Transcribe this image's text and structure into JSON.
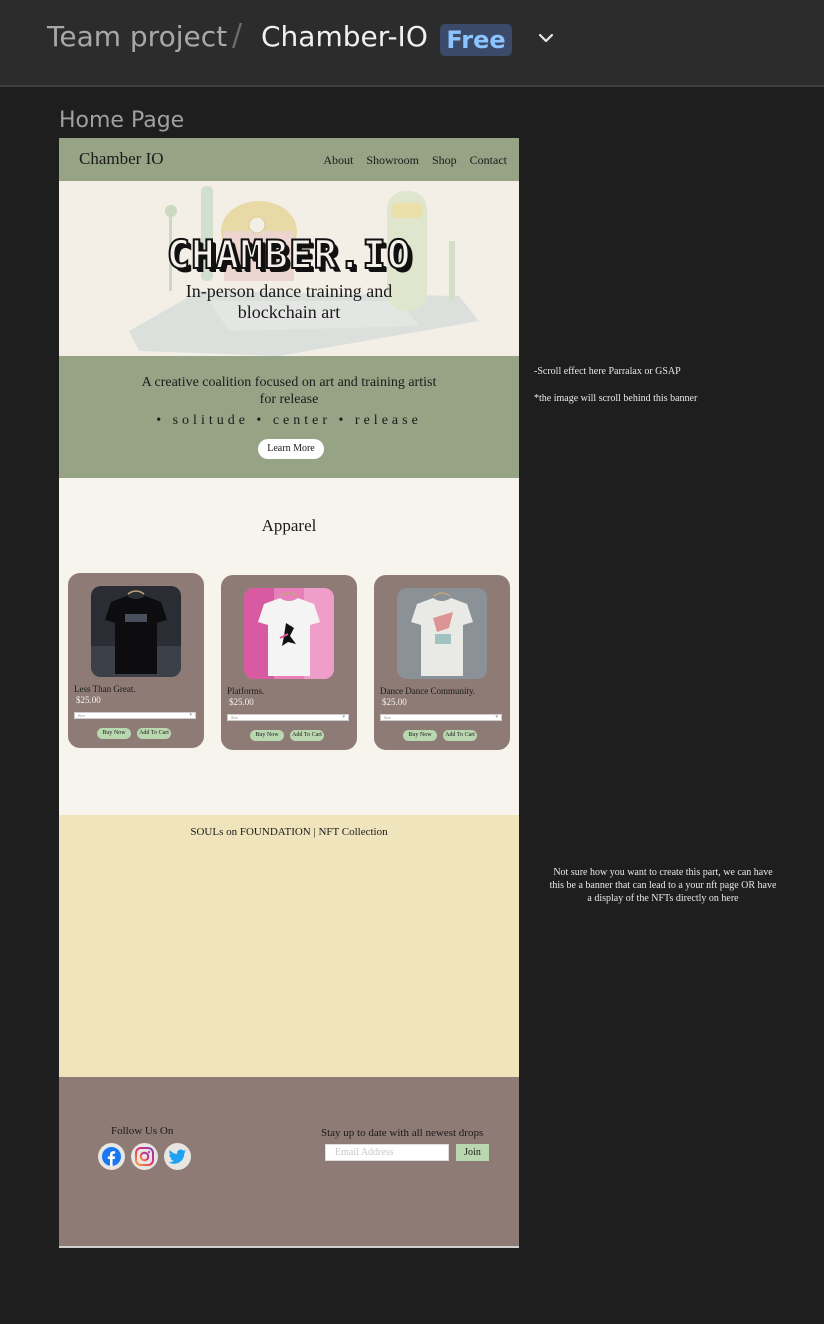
{
  "topbar": {
    "team": "Team project",
    "separator": "/",
    "project": "Chamber-IO",
    "badge": "Free"
  },
  "frame_label": "Home Page",
  "site": {
    "brand": "Chamber IO",
    "nav": [
      "About",
      "Showroom",
      "Shop",
      "Contact"
    ],
    "hero_title": "CHAMBER.IO",
    "hero_sub": [
      "In-person dance training and",
      "blockchain art"
    ],
    "banner_text": [
      "A creative coalition focused on art and training artist",
      "for release"
    ],
    "banner_tag": "• solitude • center • release",
    "learn_more": "Learn More",
    "apparel_title": "Apparel",
    "products": [
      {
        "name": "Less Than Great.",
        "price": "$25.00",
        "select": "Size",
        "buy": "Buy Now",
        "cart": "Add To Cart"
      },
      {
        "name": "Platforms.",
        "price": "$25.00",
        "select": "Size",
        "buy": "Buy Now",
        "cart": "Add To Cart"
      },
      {
        "name": "Dance Dance Community.",
        "price": "$25.00",
        "select": "Size",
        "buy": "Buy Now",
        "cart": "Add To Cart"
      }
    ],
    "nft_title": "SOULs on FOUNDATION | NFT Collection",
    "follow": "Follow Us On",
    "stay": "Stay up to date with all newest drops",
    "email_placeholder": "Email Address",
    "join": "Join"
  },
  "notes": {
    "scroll": "-Scroll effect here Parralax or GSAP",
    "image": "*the image will scroll behind this banner",
    "nft": "Not sure how you want to create this part, we can have this be a banner that can lead to a your nft page OR have a display of the NFTs directly on here"
  },
  "colors": {
    "sage": "#97a385",
    "mauve": "#8f7b76",
    "cream": "#f7f4ee",
    "butter": "#f0e4bc",
    "mint": "#b9d8b0",
    "badge_bg": "#3b4a68",
    "badge_text": "#8cc4ff"
  },
  "icons": [
    "chevron-down-icon",
    "facebook-icon",
    "instagram-icon",
    "twitter-icon"
  ]
}
